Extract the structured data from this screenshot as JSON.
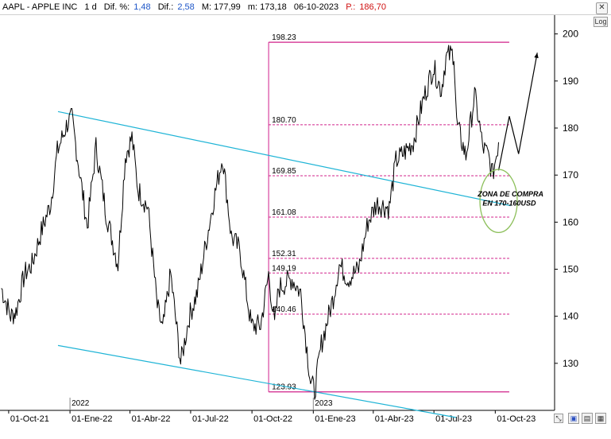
{
  "header": {
    "symbol": "AAPL - APPLE INC",
    "period": "1 d",
    "dif_pct_label": "Dif. %:",
    "dif_pct_value": "1,48",
    "dif_label": "Dif.:",
    "dif_value": "2,58",
    "high_label": "M:",
    "high_value": "177,99",
    "low_label": "m:",
    "low_value": "173,18",
    "date": "06-10-2023",
    "price_label": "P.:",
    "price_value": "186,70",
    "close_icon": "close-icon"
  },
  "controls": {
    "log_label": "Log",
    "zoom_icon": "zoom-icon",
    "save_icon": "save-icon",
    "chart_icon": "chart-type-icon"
  },
  "colors": {
    "price": "#000000",
    "channel": "#1fb4d6",
    "fibo": "#d0208a",
    "ellipse": "#8cbf5a"
  },
  "chart_data": {
    "type": "line",
    "title": "",
    "xlabel": "",
    "ylabel": "",
    "ylim": [
      120,
      204
    ],
    "x_range": [
      "2021-09-18",
      "2023-12-29"
    ],
    "y_ticks": [
      130,
      140,
      150,
      160,
      170,
      180,
      190,
      200
    ],
    "x_ticks": [
      {
        "date": "2021-10-01",
        "label": "01-Oct-21"
      },
      {
        "date": "2022-01-01",
        "label": "01-Ene-22"
      },
      {
        "date": "2022-04-01",
        "label": "01-Abr-22"
      },
      {
        "date": "2022-07-01",
        "label": "01-Jul-22"
      },
      {
        "date": "2022-10-01",
        "label": "01-Oct-22"
      },
      {
        "date": "2023-01-01",
        "label": "01-Ene-23"
      },
      {
        "date": "2023-04-01",
        "label": "01-Abr-23"
      },
      {
        "date": "2023-07-01",
        "label": "01-Jul-23"
      },
      {
        "date": "2023-10-01",
        "label": "01-Oct-23"
      }
    ],
    "year_markers": [
      {
        "date": "2022-01-01",
        "label": "2022"
      },
      {
        "date": "2023-01-01",
        "label": "2023"
      }
    ],
    "series": [
      {
        "points": [
          [
            "2021-09-20",
            146
          ],
          [
            "2021-10-04",
            140
          ],
          [
            "2021-10-12",
            141
          ],
          [
            "2021-10-25",
            149
          ],
          [
            "2021-11-05",
            151
          ],
          [
            "2021-11-19",
            158
          ],
          [
            "2021-12-03",
            164
          ],
          [
            "2021-12-13",
            175
          ],
          [
            "2021-12-28",
            181
          ],
          [
            "2022-01-04",
            182
          ],
          [
            "2022-01-12",
            174
          ],
          [
            "2022-01-27",
            159
          ],
          [
            "2022-02-09",
            176
          ],
          [
            "2022-02-24",
            162
          ],
          [
            "2022-03-14",
            151
          ],
          [
            "2022-03-25",
            174
          ],
          [
            "2022-04-04",
            178
          ],
          [
            "2022-04-13",
            167
          ],
          [
            "2022-04-28",
            163
          ],
          [
            "2022-05-12",
            142
          ],
          [
            "2022-05-20",
            137
          ],
          [
            "2022-06-01",
            149
          ],
          [
            "2022-06-16",
            130
          ],
          [
            "2022-06-29",
            140
          ],
          [
            "2022-07-11",
            145
          ],
          [
            "2022-07-22",
            154
          ],
          [
            "2022-08-05",
            165
          ],
          [
            "2022-08-18",
            174
          ],
          [
            "2022-08-31",
            157
          ],
          [
            "2022-09-13",
            154
          ],
          [
            "2022-09-30",
            138
          ],
          [
            "2022-10-14",
            138
          ],
          [
            "2022-10-26",
            149
          ],
          [
            "2022-11-04",
            138
          ],
          [
            "2022-11-10",
            146
          ],
          [
            "2022-11-30",
            148
          ],
          [
            "2022-12-13",
            145
          ],
          [
            "2022-12-28",
            126
          ],
          [
            "2023-01-03",
            124
          ],
          [
            "2023-01-13",
            134
          ],
          [
            "2023-01-31",
            144
          ],
          [
            "2023-02-09",
            151
          ],
          [
            "2023-02-22",
            148
          ],
          [
            "2023-03-10",
            150
          ],
          [
            "2023-03-24",
            160
          ],
          [
            "2023-04-06",
            164
          ],
          [
            "2023-04-25",
            163
          ],
          [
            "2023-05-05",
            173
          ],
          [
            "2023-05-19",
            175
          ],
          [
            "2023-05-31",
            177
          ],
          [
            "2023-06-15",
            186
          ],
          [
            "2023-06-30",
            193
          ],
          [
            "2023-07-12",
            188
          ],
          [
            "2023-07-19",
            195
          ],
          [
            "2023-07-31",
            196
          ],
          [
            "2023-08-04",
            181
          ],
          [
            "2023-08-18",
            174
          ],
          [
            "2023-08-31",
            187
          ],
          [
            "2023-09-06",
            182
          ],
          [
            "2023-09-12",
            176
          ],
          [
            "2023-09-21",
            174
          ],
          [
            "2023-09-27",
            170
          ],
          [
            "2023-10-06",
            177
          ]
        ]
      }
    ],
    "fibonacci_levels": [
      198.23,
      180.7,
      169.85,
      161.08,
      152.31,
      149.19,
      140.46,
      123.93
    ],
    "fibonacci_labels": [
      "198.23",
      "180.70",
      "169.85",
      "161.08",
      "152.31",
      "149.19",
      "140.46",
      "123.93"
    ],
    "fibonacci_range": [
      "2022-10-26",
      "2023-10-22"
    ],
    "channel_lines": [
      {
        "start": [
          "2021-12-14",
          183.5
        ],
        "end": [
          "2023-10-24",
          163.5
        ]
      },
      {
        "start": [
          "2021-12-14",
          133.8
        ],
        "end": [
          "2023-08-03",
          118.5
        ]
      }
    ],
    "projection": [
      [
        "2023-10-06",
        171
      ],
      [
        "2023-10-22",
        182.5
      ],
      [
        "2023-11-05",
        174.5
      ],
      [
        "2023-12-03",
        196
      ]
    ],
    "annotations": [
      {
        "text": "ZONA DE COMPRA",
        "x": "2023-10-24",
        "y": 165.5
      },
      {
        "text": "EN 170-160USD",
        "x": "2023-10-22",
        "y": 163.5
      }
    ],
    "ellipse": {
      "center": [
        "2023-10-06",
        164.5
      ],
      "rx_days": 28,
      "ry": 6.7
    },
    "grid": false
  }
}
